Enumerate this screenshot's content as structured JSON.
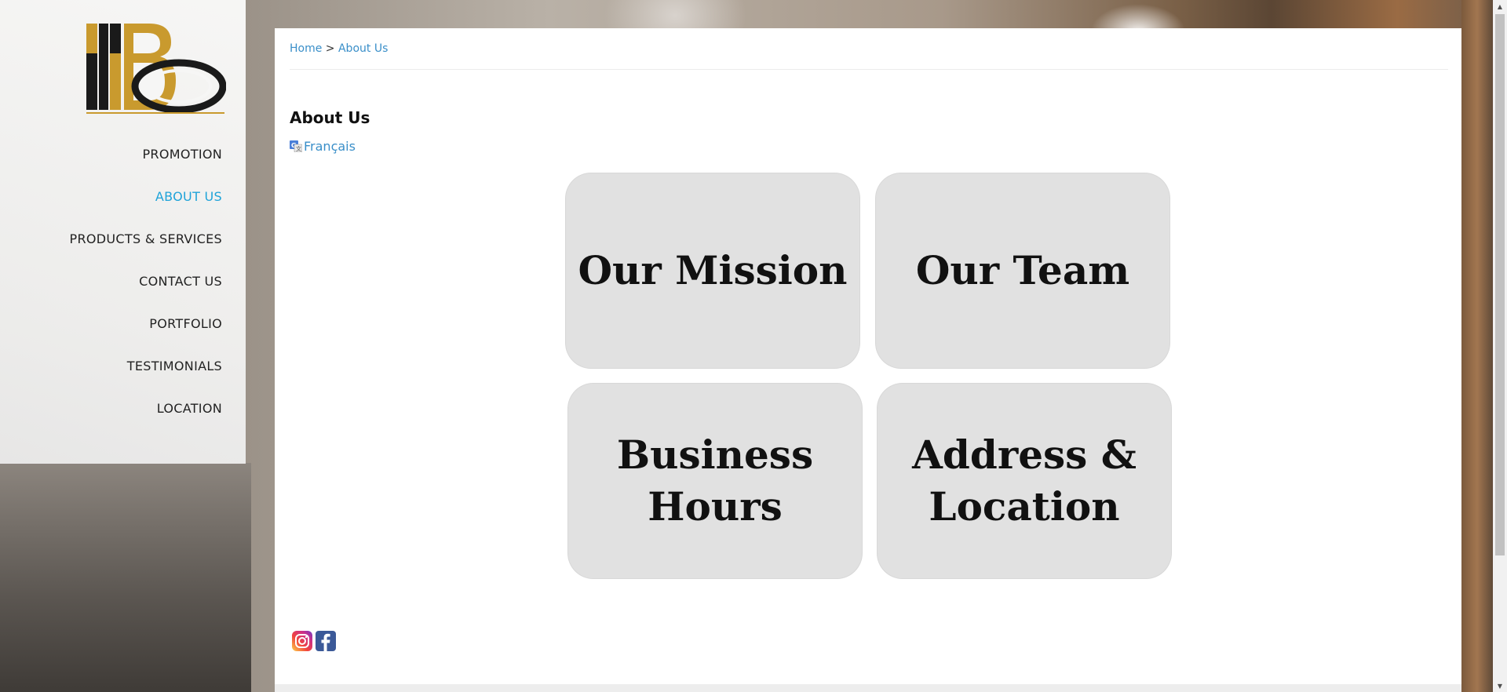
{
  "sidebar": {
    "logo_name": "company-logo",
    "nav": [
      {
        "label": "PROMOTION",
        "active": false
      },
      {
        "label": "ABOUT US",
        "active": true
      },
      {
        "label": "PRODUCTS & SERVICES",
        "active": false
      },
      {
        "label": "CONTACT US",
        "active": false
      },
      {
        "label": "PORTFOLIO",
        "active": false
      },
      {
        "label": "TESTIMONIALS",
        "active": false
      },
      {
        "label": "LOCATION",
        "active": false
      }
    ]
  },
  "breadcrumb": {
    "home": "Home",
    "separator": ">",
    "current": "About Us"
  },
  "page": {
    "title": "About Us",
    "translate_label": "Français"
  },
  "cards": [
    {
      "label": "Our Mission"
    },
    {
      "label": "Our Team"
    },
    {
      "label": "Business Hours"
    },
    {
      "label": "Address & Location"
    }
  ],
  "social": {
    "instagram": "instagram-icon",
    "facebook": "facebook-icon"
  },
  "colors": {
    "accent": "#1fa3d9",
    "link": "#3a8fc9",
    "gold": "#c99a2e",
    "card_bg": "#e1e1e1"
  }
}
